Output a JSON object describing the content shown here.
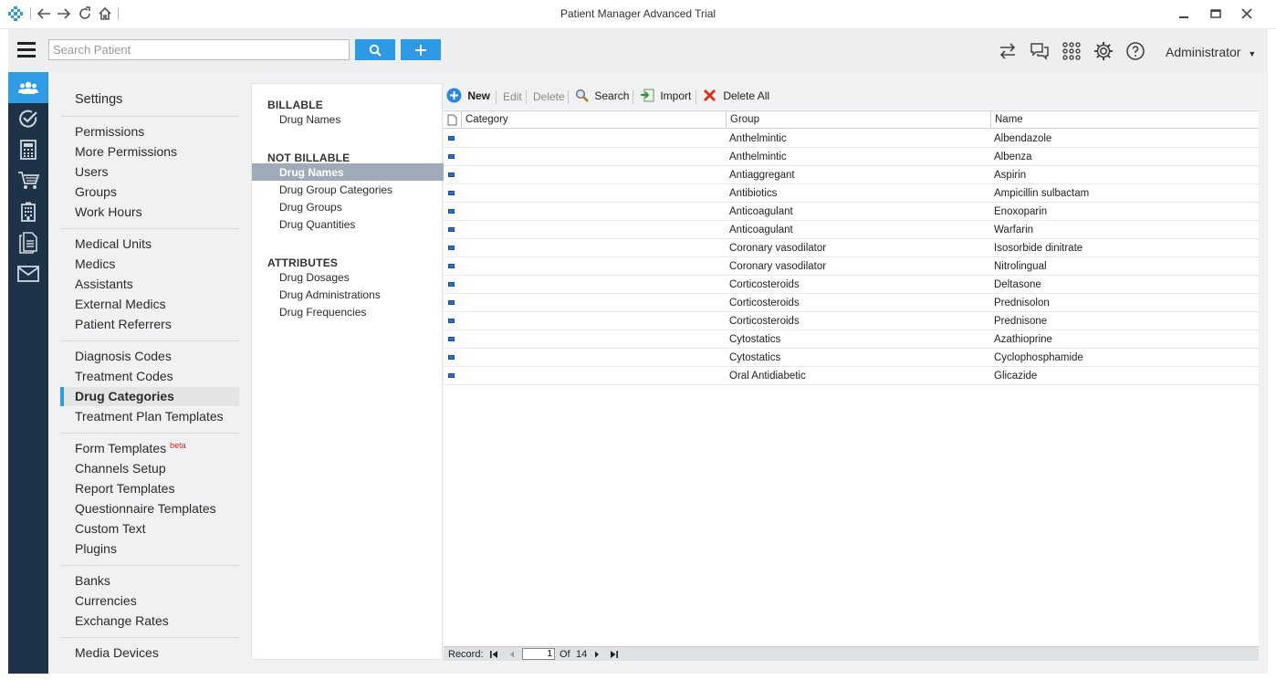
{
  "window": {
    "title": "Patient Manager Advanced Trial"
  },
  "toolbar": {
    "search_placeholder": "Search Patient",
    "user": "Administrator",
    "accent": "#2e9ae6"
  },
  "rail": {
    "icons": [
      "users-icon",
      "check-circle-icon",
      "calculator-icon",
      "cart-icon",
      "building-icon",
      "document-icon",
      "mail-icon"
    ],
    "active_index": 0
  },
  "settings": {
    "title": "Settings",
    "items": [
      "Permissions",
      "More Permissions",
      "Users",
      "Groups",
      "Work Hours",
      "Medical Units",
      "Medics",
      "Assistants",
      "External Medics",
      "Patient Referrers",
      "Diagnosis Codes",
      "Treatment Codes",
      "Drug Categories",
      "Treatment Plan Templates",
      "Form Templates",
      "Channels Setup",
      "Report Templates",
      "Questionnaire Templates",
      "Custom Text",
      "Plugins",
      "Banks",
      "Currencies",
      "Exchange Rates",
      "Media Devices"
    ],
    "beta_label": "beta",
    "active": "Drug Categories"
  },
  "subnav": {
    "billable": "BILLABLE",
    "billable_items": [
      "Drug Names"
    ],
    "not_billable": "NOT BILLABLE",
    "not_billable_items": [
      "Drug Names",
      "Drug Group Categories",
      "Drug Groups",
      "Drug Quantities"
    ],
    "attributes": "ATTRIBUTES",
    "attributes_items": [
      "Drug Dosages",
      "Drug Administrations",
      "Drug Frequencies"
    ],
    "active": "Drug Names"
  },
  "grid_toolbar": {
    "new": "New",
    "edit": "Edit",
    "delete": "Delete",
    "search": "Search",
    "import": "Import",
    "delete_all": "Delete All"
  },
  "grid": {
    "columns": [
      "Category",
      "Group",
      "Name"
    ],
    "rows": [
      {
        "category": "",
        "group": "Anthelmintic",
        "name": "Albendazole"
      },
      {
        "category": "",
        "group": "Anthelmintic",
        "name": "Albenza"
      },
      {
        "category": "",
        "group": "Antiaggregant",
        "name": "Aspirin"
      },
      {
        "category": "",
        "group": "Antibiotics",
        "name": "Ampicillin sulbactam"
      },
      {
        "category": "",
        "group": "Anticoagulant",
        "name": "Enoxoparin"
      },
      {
        "category": "",
        "group": "Anticoagulant",
        "name": "Warfarin"
      },
      {
        "category": "",
        "group": "Coronary vasodilator",
        "name": "Isosorbide dinitrate"
      },
      {
        "category": "",
        "group": "Coronary vasodilator",
        "name": "Nitrolingual"
      },
      {
        "category": "",
        "group": "Corticosteroids",
        "name": "Deltasone"
      },
      {
        "category": "",
        "group": "Corticosteroids",
        "name": "Prednisolon"
      },
      {
        "category": "",
        "group": "Corticosteroids",
        "name": "Prednisone"
      },
      {
        "category": "",
        "group": "Cytostatics",
        "name": "Azathioprine"
      },
      {
        "category": "",
        "group": "Cytostatics",
        "name": "Cyclophosphamide"
      },
      {
        "category": "",
        "group": "Oral Antidiabetic",
        "name": "Glicazide"
      }
    ]
  },
  "footer": {
    "record_label": "Record:",
    "current": "1",
    "of_label": "Of",
    "total": "14"
  }
}
